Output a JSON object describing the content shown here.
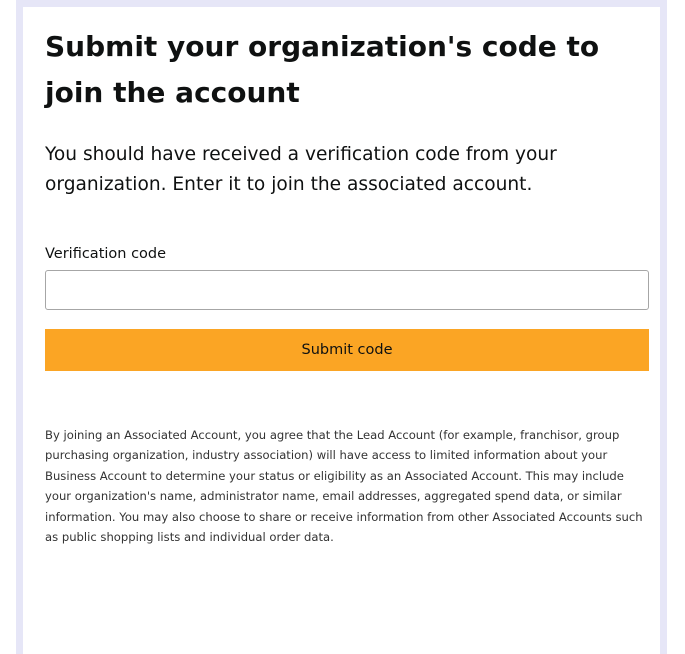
{
  "header": {
    "title": "Submit your organization's code to join the account"
  },
  "main": {
    "description": "You should have received a verification code from your organization. Enter it to join the associated account.",
    "verification_label": "Verification code",
    "verification_value": "",
    "submit_label": "Submit code",
    "legal_text": "By joining an Associated Account, you agree that the Lead Account (for example, franchisor, group purchasing organization, industry association) will have access to limited information about your Business Account to determine your status or eligibility as an Associated Account. This may include your organization's name, administrator name, email addresses, aggregated spend data, or similar information. You may also choose to share or receive information from other Associated Accounts such as public shopping lists and individual order data."
  },
  "colors": {
    "frame": "#e6e6f7",
    "button": "#fba524",
    "input_border": "#a6a6a6",
    "text": "#0f1111"
  }
}
